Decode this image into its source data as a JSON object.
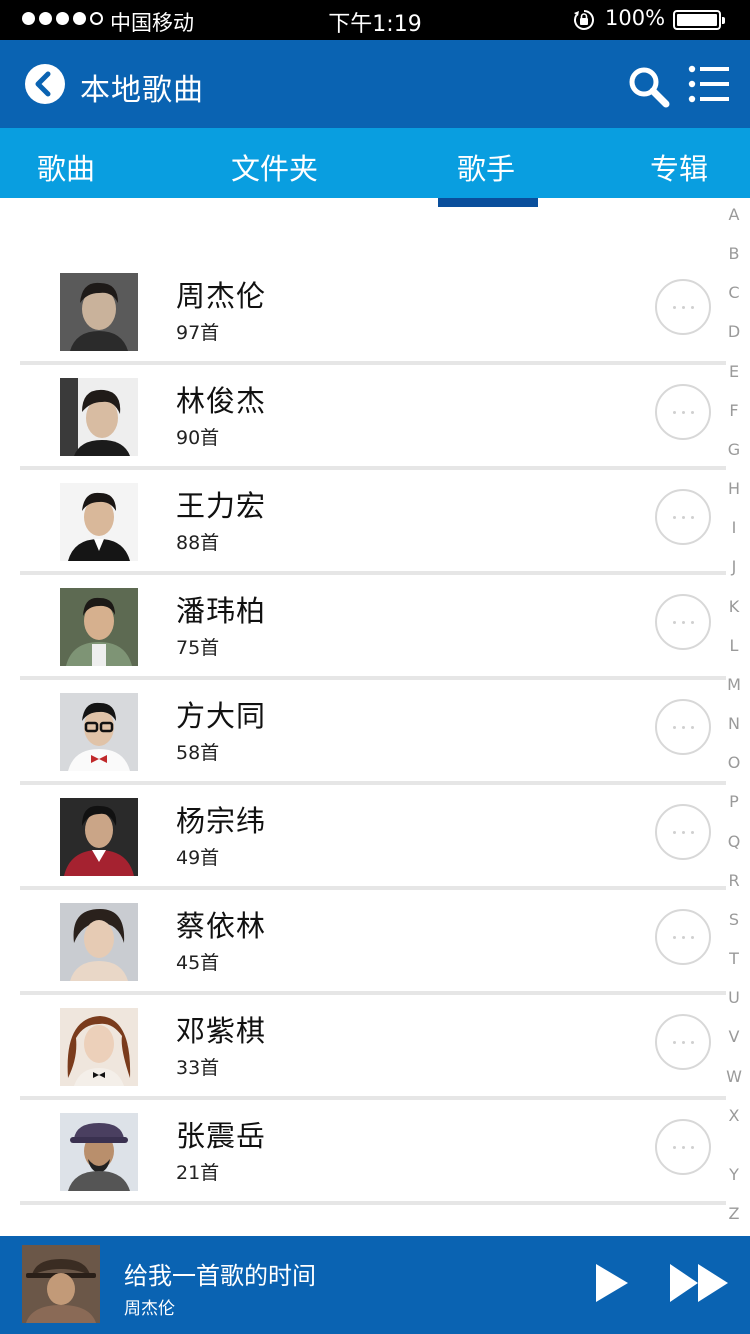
{
  "status_bar": {
    "carrier": "中国移动",
    "time": "下午1:19",
    "battery": "100%"
  },
  "header": {
    "title": "本地歌曲",
    "back_icon": "chevron-left-icon",
    "search_icon": "search-icon",
    "menu_icon": "list-menu-icon"
  },
  "tabs": [
    {
      "label": "歌曲",
      "active": false
    },
    {
      "label": "文件夹",
      "active": false
    },
    {
      "label": "歌手",
      "active": true
    },
    {
      "label": "专辑",
      "active": false
    }
  ],
  "artists": [
    {
      "name": "周杰伦",
      "count": "97首"
    },
    {
      "name": "林俊杰",
      "count": "90首"
    },
    {
      "name": "王力宏",
      "count": "88首"
    },
    {
      "name": "潘玮柏",
      "count": "75首"
    },
    {
      "name": "方大同",
      "count": "58首"
    },
    {
      "name": "杨宗纬",
      "count": "49首"
    },
    {
      "name": "蔡依林",
      "count": "45首"
    },
    {
      "name": "邓紫棋",
      "count": "33首"
    },
    {
      "name": "张震岳",
      "count": "21首"
    }
  ],
  "alphabet": [
    "A",
    "B",
    "C",
    "D",
    "E",
    "F",
    "G",
    "H",
    "I",
    "J",
    "K",
    "L",
    "M",
    "N",
    "O",
    "P",
    "Q",
    "R",
    "S",
    "T",
    "U",
    "V",
    "W",
    "X",
    "Y",
    "Z"
  ],
  "player": {
    "title": "给我一首歌的时间",
    "artist": "周杰伦"
  },
  "colors": {
    "header": "#0a63b2",
    "tabs": "#099ee0",
    "indicator": "#0a4f9c"
  }
}
